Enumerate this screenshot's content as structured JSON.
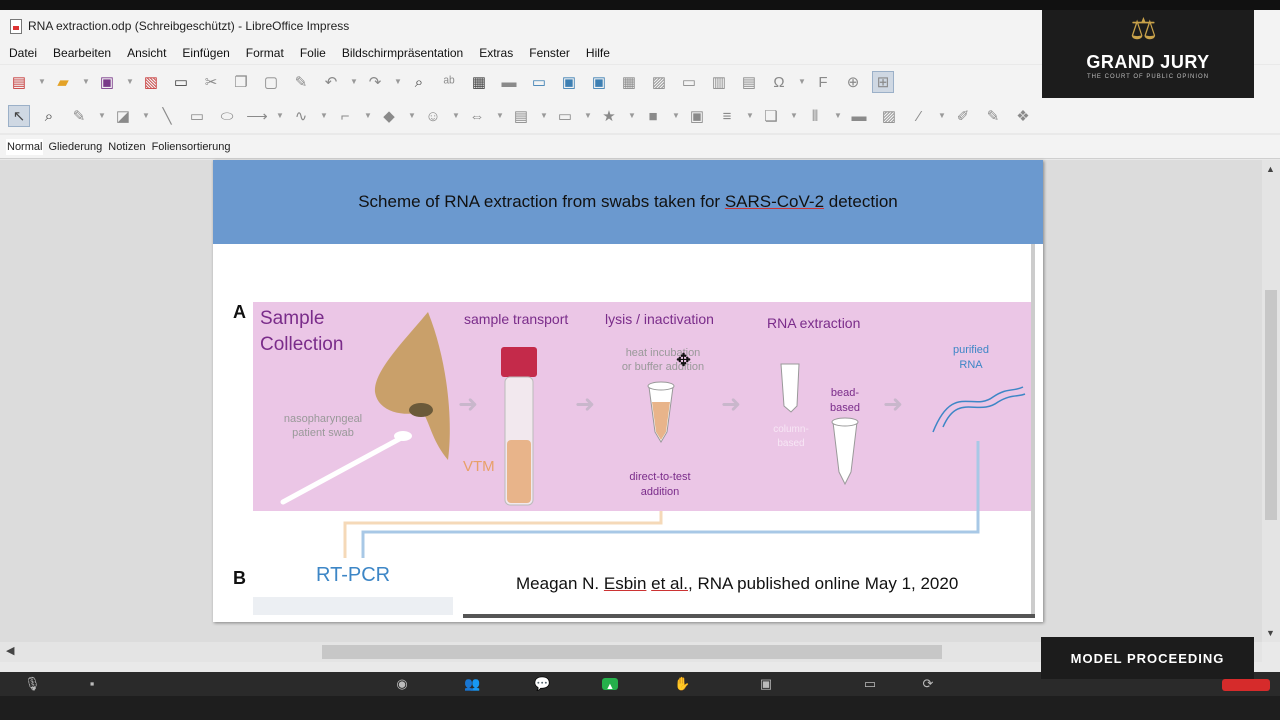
{
  "window": {
    "title": "RNA extraction.odp (Schreibgeschützt) - LibreOffice Impress"
  },
  "menu": {
    "items": [
      "Datei",
      "Bearbeiten",
      "Ansicht",
      "Einfügen",
      "Format",
      "Folie",
      "Bildschirmpräsentation",
      "Extras",
      "Fenster",
      "Hilfe"
    ]
  },
  "view_tabs": {
    "items": [
      "Normal",
      "Gliederung",
      "Notizen",
      "Foliensortierung"
    ],
    "active": "Normal"
  },
  "slide": {
    "title_pre": "Scheme of RNA extraction from swabs taken for ",
    "title_term": "SARS-CoV-2",
    "title_post": " detection",
    "panel_a_letter": "A",
    "panel_b_letter": "B",
    "sample_collection": "Sample\nCollection",
    "swab_label": "nasopharyngeal\npatient swab",
    "sample_transport": "sample transport",
    "vtm": "VTM",
    "lysis": "lysis / inactivation",
    "heat_label": "heat incubation\nor buffer addition",
    "direct_label": "direct-to-test\naddition",
    "rna_extraction": "RNA extraction",
    "bead_label": "bead-\nbased",
    "purified": "purified\nRNA",
    "rtpcr": "RT-PCR",
    "citation_pre": "Meagan N. ",
    "citation_name": "Esbin",
    "citation_mid": " ",
    "citation_etal": "et al.",
    "citation_post": ", RNA published online May 1, 2020"
  },
  "overlay": {
    "brand": "GRAND JURY",
    "tagline": "THE COURT OF PUBLIC OPINION",
    "badge": "MODEL PROCEEDING"
  },
  "colors": {
    "header_blue": "#6b99cf",
    "panel_pink": "#ebc6e6",
    "label_purple": "#7a2c8a",
    "rtpcr_blue": "#3d86c6"
  }
}
